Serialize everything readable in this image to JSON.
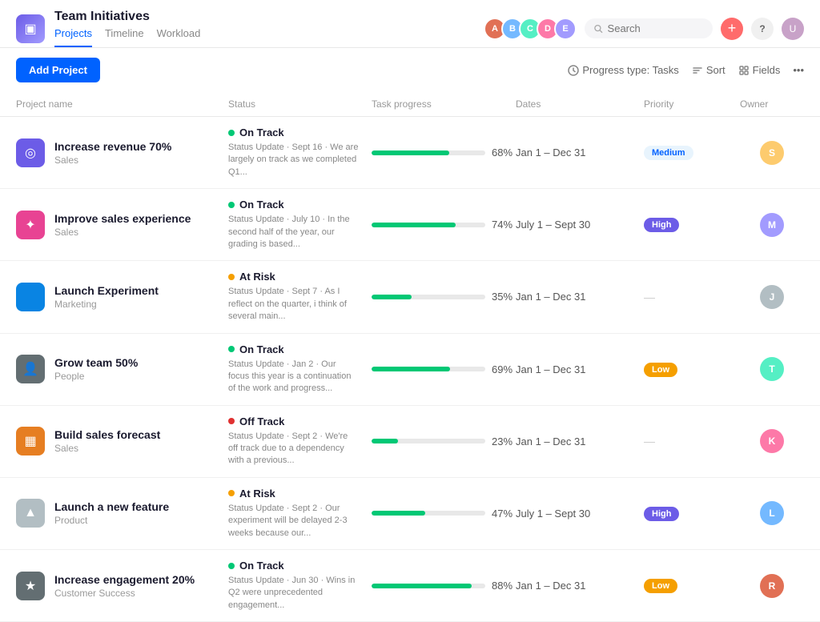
{
  "app": {
    "icon": "▣",
    "title": "Team Initiatives",
    "nav": [
      {
        "label": "Projects",
        "active": true
      },
      {
        "label": "Timeline",
        "active": false
      },
      {
        "label": "Workload",
        "active": false
      }
    ]
  },
  "header": {
    "search_placeholder": "Search",
    "add_icon": "+",
    "help_label": "?",
    "avatars": [
      {
        "color": "#e17055",
        "initials": "A"
      },
      {
        "color": "#74b9ff",
        "initials": "B"
      },
      {
        "color": "#55efc4",
        "initials": "C"
      },
      {
        "color": "#fd79a8",
        "initials": "D"
      },
      {
        "color": "#a29bfe",
        "initials": "E"
      }
    ]
  },
  "toolbar": {
    "add_project_label": "Add Project",
    "progress_type_label": "Progress type: Tasks",
    "sort_label": "Sort",
    "fields_label": "Fields",
    "more_icon": "•••"
  },
  "table": {
    "columns": [
      "Project name",
      "Status",
      "Task progress",
      "Dates",
      "Priority",
      "Owner"
    ],
    "rows": [
      {
        "id": 1,
        "name": "Increase revenue 70%",
        "category": "Sales",
        "icon_bg": "#6c5ce7",
        "icon": "◎",
        "status": "On Track",
        "status_type": "green",
        "status_desc": "Status Update · Sept 16 · We are largely on track as we completed Q1...",
        "progress": 68,
        "dates": "Jan 1 – Dec 31",
        "priority": "Medium",
        "priority_type": "medium",
        "owner_color": "#fdcb6e",
        "owner_initials": "S"
      },
      {
        "id": 2,
        "name": "Improve sales experience",
        "category": "Sales",
        "icon_bg": "#e84393",
        "icon": "✦",
        "status": "On Track",
        "status_type": "green",
        "status_desc": "Status Update · July 10 · In the second half of the year, our grading is based...",
        "progress": 74,
        "dates": "July 1 – Sept 30",
        "priority": "High",
        "priority_type": "high",
        "owner_color": "#a29bfe",
        "owner_initials": "M"
      },
      {
        "id": 3,
        "name": "Launch Experiment",
        "category": "Marketing",
        "icon_bg": "#0984e3",
        "icon": "</>",
        "status": "At Risk",
        "status_type": "orange",
        "status_desc": "Status Update · Sept 7 · As I reflect on the quarter, i think of several main...",
        "progress": 35,
        "dates": "Jan 1 – Dec 31",
        "priority": "—",
        "priority_type": "none",
        "owner_color": "#b2bec3",
        "owner_initials": "J"
      },
      {
        "id": 4,
        "name": "Grow team 50%",
        "category": "People",
        "icon_bg": "#636e72",
        "icon": "👤",
        "status": "On Track",
        "status_type": "green",
        "status_desc": "Status Update · Jan 2 · Our focus this year is a continuation of the work and progress...",
        "progress": 69,
        "dates": "Jan 1 – Dec 31",
        "priority": "Low",
        "priority_type": "low",
        "owner_color": "#55efc4",
        "owner_initials": "T"
      },
      {
        "id": 5,
        "name": "Build sales forecast",
        "category": "Sales",
        "icon_bg": "#e67e22",
        "icon": "▦",
        "status": "Off Track",
        "status_type": "red",
        "status_desc": "Status Update · Sept 2 · We're off track due to a dependency with a previous...",
        "progress": 23,
        "dates": "Jan 1 – Dec 31",
        "priority": "—",
        "priority_type": "none",
        "owner_color": "#fd79a8",
        "owner_initials": "K"
      },
      {
        "id": 6,
        "name": "Launch a new feature",
        "category": "Product",
        "icon_bg": "#b2bec3",
        "icon": "▲",
        "status": "At Risk",
        "status_type": "orange",
        "status_desc": "Status Update · Sept 2 · Our experiment will be delayed 2-3 weeks because our...",
        "progress": 47,
        "dates": "July 1 – Sept 30",
        "priority": "High",
        "priority_type": "high",
        "owner_color": "#74b9ff",
        "owner_initials": "L"
      },
      {
        "id": 7,
        "name": "Increase engagement 20%",
        "category": "Customer Success",
        "icon_bg": "#636e72",
        "icon": "★",
        "status": "On Track",
        "status_type": "green",
        "status_desc": "Status Update · Jun 30 · Wins in Q2 were unprecedented engagement...",
        "progress": 88,
        "dates": "Jan 1 – Dec 31",
        "priority": "Low",
        "priority_type": "low",
        "owner_color": "#e17055",
        "owner_initials": "R"
      }
    ]
  }
}
